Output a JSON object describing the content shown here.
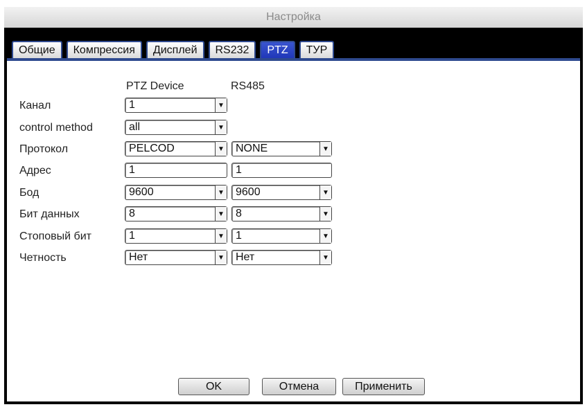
{
  "window": {
    "title": "Настройка"
  },
  "tabs": [
    {
      "label": "Общие"
    },
    {
      "label": "Компрессия"
    },
    {
      "label": "Дисплей"
    },
    {
      "label": "RS232"
    },
    {
      "label": "PTZ"
    },
    {
      "label": "ТУР"
    }
  ],
  "columns": {
    "ptz_device": "PTZ Device",
    "rs485": "RS485"
  },
  "rows": {
    "channel": {
      "label": "Канал",
      "ptz": "1"
    },
    "control_method": {
      "label": "control method",
      "ptz": "all"
    },
    "protocol": {
      "label": "Протокол",
      "ptz": "PELCOD",
      "rs485": "NONE"
    },
    "address": {
      "label": "Адрес",
      "ptz": "1",
      "rs485": "1"
    },
    "baud": {
      "label": "Бод",
      "ptz": "9600",
      "rs485": "9600"
    },
    "data_bits": {
      "label": "Бит данных",
      "ptz": "8",
      "rs485": "8"
    },
    "stop_bit": {
      "label": "Стоповый бит",
      "ptz": "1",
      "rs485": "1"
    },
    "parity": {
      "label": "Четность",
      "ptz": "Нет",
      "rs485": "Нет"
    }
  },
  "buttons": {
    "ok": "OK",
    "cancel": "Отмена",
    "apply": "Применить"
  },
  "icons": {
    "dropdown": "chevron-down-icon"
  }
}
